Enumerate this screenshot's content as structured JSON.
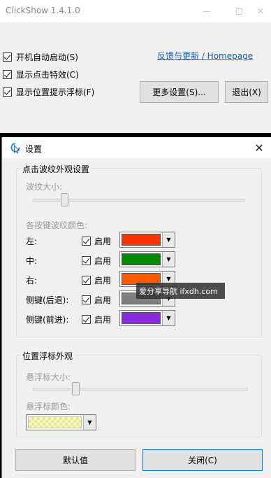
{
  "main": {
    "title": "ClickShow 1.4.1.0",
    "checkboxes": [
      {
        "label": "开机自动启动(S)",
        "checked": true
      },
      {
        "label": "显示点击特效(C)",
        "checked": true
      },
      {
        "label": "显示位置提示浮标(F)",
        "checked": true
      }
    ],
    "link": "反馈与更新 / Homepage",
    "more_button": "更多设置(S)...",
    "exit_button": "退出(X)"
  },
  "settings": {
    "title": "设置",
    "ripple_group": {
      "title": "点击波纹外观设置",
      "size_label": "波纹大小:",
      "size_value": 0.15,
      "colors_label": "各按键波纹颜色:",
      "rows": [
        {
          "label": "左:",
          "enable": "启用",
          "checked": true,
          "color": "#ff3300"
        },
        {
          "label": "中:",
          "enable": "启用",
          "checked": true,
          "color": "#008a00"
        },
        {
          "label": "右:",
          "enable": "启用",
          "checked": true,
          "color": "#ff5a00"
        },
        {
          "label": "侧键(后退):",
          "enable": "启用",
          "checked": true,
          "color": "#7f7f7f"
        },
        {
          "label": "侧键(前进):",
          "enable": "启用",
          "checked": true,
          "color": "#8a2be2"
        }
      ]
    },
    "marker_group": {
      "title": "位置浮标外观",
      "size_label": "悬浮标大小:",
      "size_value": 0.2,
      "color_label": "悬浮标颜色:"
    },
    "default_button": "默认值",
    "close_button": "关闭(C)"
  },
  "watermark": "爱分享导航 ifxdh.com"
}
